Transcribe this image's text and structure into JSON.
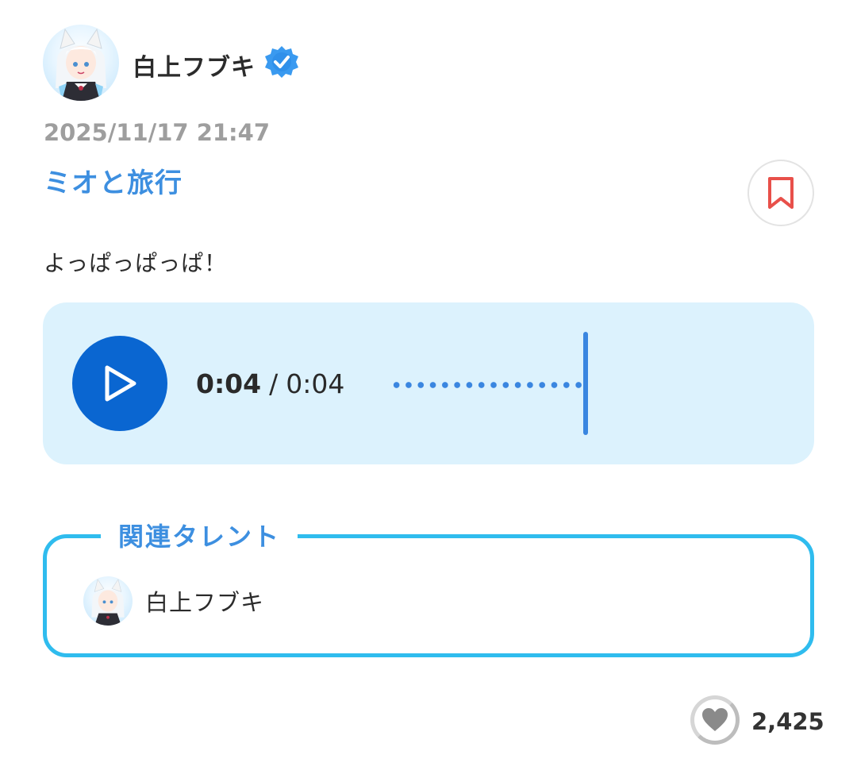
{
  "author": {
    "name": "白上フブキ",
    "verified": true,
    "avatar_icon": "avatar-image-icon"
  },
  "post": {
    "timestamp": "2025/11/17 21:47",
    "title": "ミオと旅行",
    "body": "よっぱっぱっぱ！",
    "bookmark_icon": "bookmark-icon"
  },
  "audio": {
    "current_time": "0:04",
    "separator": "/",
    "duration": "0:04",
    "progress": 1.0,
    "play_icon": "play-icon"
  },
  "related": {
    "label": "関連タレント",
    "talents": [
      {
        "name": "白上フブキ"
      }
    ]
  },
  "likes": {
    "count": "2,425",
    "icon": "heart-icon"
  },
  "colors": {
    "accent_blue": "#3d8fe0",
    "play_button": "#0a66d1",
    "audio_bg": "#dcf2fd",
    "related_border": "#2fbcee",
    "bookmark_red": "#e8504a",
    "timestamp_gray": "#9e9e9e"
  }
}
